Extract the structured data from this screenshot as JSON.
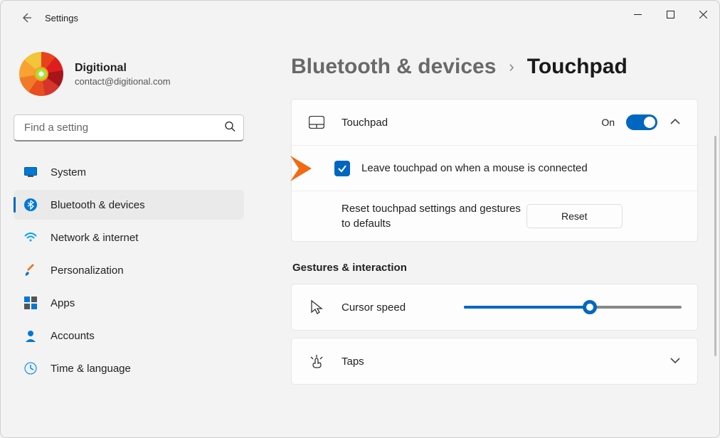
{
  "window": {
    "title": "Settings"
  },
  "profile": {
    "name": "Digitional",
    "email": "contact@digitional.com"
  },
  "search": {
    "placeholder": "Find a setting"
  },
  "nav": [
    {
      "key": "system",
      "label": "System"
    },
    {
      "key": "bluetooth",
      "label": "Bluetooth & devices"
    },
    {
      "key": "network",
      "label": "Network & internet"
    },
    {
      "key": "personalization",
      "label": "Personalization"
    },
    {
      "key": "apps",
      "label": "Apps"
    },
    {
      "key": "accounts",
      "label": "Accounts"
    },
    {
      "key": "time",
      "label": "Time & language"
    }
  ],
  "breadcrumb": {
    "parent": "Bluetooth & devices",
    "current": "Touchpad"
  },
  "touchpad": {
    "label": "Touchpad",
    "state_text": "On",
    "leave_on_label": "Leave touchpad on when a mouse is connected",
    "reset_desc": "Reset touchpad settings and gestures to defaults",
    "reset_button": "Reset"
  },
  "section_gestures": "Gestures & interaction",
  "cursor_speed": {
    "label": "Cursor speed"
  },
  "taps": {
    "label": "Taps"
  }
}
